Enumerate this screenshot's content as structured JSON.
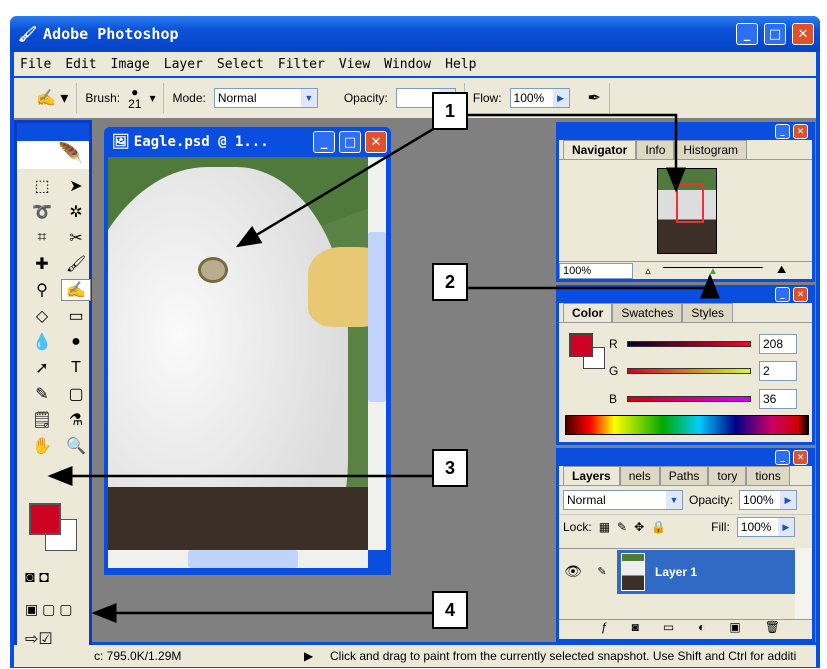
{
  "app": {
    "title": "Adobe Photoshop"
  },
  "menu": [
    "File",
    "Edit",
    "Image",
    "Layer",
    "Select",
    "Filter",
    "View",
    "Window",
    "Help"
  ],
  "options": {
    "brush_label": "Brush:",
    "brush_size": "21",
    "mode_label": "Mode:",
    "mode_value": "Normal",
    "opacity_label": "Opacity:",
    "flow_label": "Flow:",
    "flow_value": "100%"
  },
  "document": {
    "title": "Eagle.psd @ 1..."
  },
  "navigator": {
    "tabs": [
      "Navigator",
      "Info",
      "Histogram"
    ],
    "zoom": "100%",
    "zoom_slider_fraction": 0.5
  },
  "color": {
    "tabs": [
      "Color",
      "Swatches",
      "Styles"
    ],
    "foreground": "#d00224",
    "R": "208",
    "G": "2",
    "B": "36"
  },
  "layers": {
    "tabs": [
      "Layers",
      "nels",
      "Paths",
      "tory",
      "tions"
    ],
    "blend": "Normal",
    "opacity_label": "Opacity:",
    "opacity": "100%",
    "lock_label": "Lock:",
    "fill_label": "Fill:",
    "fill": "100%",
    "layer_name": "Layer 1"
  },
  "status": {
    "doc_size": "c: 795.0K/1.29M",
    "hint": "Click and drag to paint from the currently selected snapshot.  Use Shift and Ctrl for additi"
  },
  "callouts": [
    "1",
    "2",
    "3",
    "4"
  ]
}
